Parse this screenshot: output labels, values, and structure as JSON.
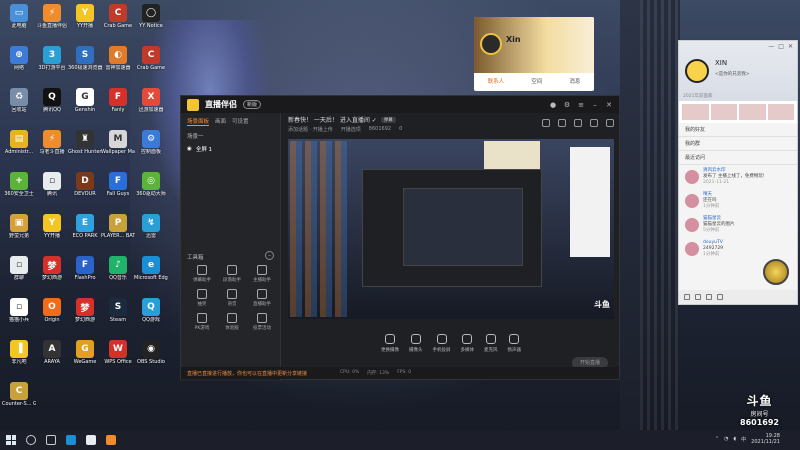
{
  "desktop": {
    "icons": [
      {
        "label": "此电脑",
        "color": "#4a90d9",
        "glyph": "▭"
      },
      {
        "label": "斗鱼直播伴侣",
        "color": "#f08c2c",
        "glyph": "⚡"
      },
      {
        "label": "YY开播",
        "color": "#f3c623",
        "glyph": "Y"
      },
      {
        "label": "Crab Game",
        "color": "#c0392b",
        "glyph": "C"
      },
      {
        "label": "YY Notice",
        "color": "#222",
        "glyph": "◯"
      },
      {
        "label": "网络",
        "color": "#3e7ad8",
        "glyph": "⊕"
      },
      {
        "label": "3D打游平台",
        "color": "#2a9fd6",
        "glyph": "3"
      },
      {
        "label": "360极速浏览器",
        "color": "#2f6fbf",
        "glyph": "S"
      },
      {
        "label": "雷神加速器",
        "color": "#e07b2a",
        "glyph": "◐"
      },
      {
        "label": "Crab Game",
        "color": "#c0392b",
        "glyph": "C"
      },
      {
        "label": "回收站",
        "color": "#7a8da8",
        "glyph": "♻"
      },
      {
        "label": "腾讯QQ",
        "color": "#111",
        "glyph": "Q"
      },
      {
        "label": "Genshin",
        "color": "#ffffff",
        "glyph": "G"
      },
      {
        "label": "Fanly",
        "color": "#d6302b",
        "glyph": "F"
      },
      {
        "label": "迅游加速器",
        "color": "#e24b3a",
        "glyph": "X"
      },
      {
        "label": "Administr...",
        "color": "#e6b422",
        "glyph": "▤"
      },
      {
        "label": "马老斗直播",
        "color": "#f08c2c",
        "glyph": "⚡"
      },
      {
        "label": "Ghost Hunters",
        "color": "#333",
        "glyph": "♜"
      },
      {
        "label": "Wallpaper Maker",
        "color": "#d6d6d6",
        "glyph": "M"
      },
      {
        "label": "控制面板",
        "color": "#3a7bd5",
        "glyph": "⚙"
      },
      {
        "label": "360安全卫士",
        "color": "#5bb33a",
        "glyph": "+"
      },
      {
        "label": "腾讯",
        "color": "#e9ecef",
        "glyph": "▫"
      },
      {
        "label": "DEVOUR",
        "color": "#7a3a1a",
        "glyph": "D"
      },
      {
        "label": "Fall Guys",
        "color": "#2a6fd8",
        "glyph": "F"
      },
      {
        "label": "360驱动大师",
        "color": "#5bb33a",
        "glyph": "◎"
      },
      {
        "label": "野蛮兄弟",
        "color": "#d7a13a",
        "glyph": "▣"
      },
      {
        "label": "YY开播",
        "color": "#f3c623",
        "glyph": "Y"
      },
      {
        "label": "ECO PARK",
        "color": "#2fa1e0",
        "glyph": "E"
      },
      {
        "label": "PLAYER... BATTLEGR...",
        "color": "#c9a13a",
        "glyph": "P"
      },
      {
        "label": "迅雷",
        "color": "#2a9fd6",
        "glyph": "↯"
      },
      {
        "label": "群聊",
        "color": "#e9ecef",
        "glyph": "▫"
      },
      {
        "label": "梦幻西游",
        "color": "#d6302b",
        "glyph": "梦"
      },
      {
        "label": "FlashPro",
        "color": "#2a63c9",
        "glyph": "F"
      },
      {
        "label": "QQ音乐",
        "color": "#1fb46a",
        "glyph": "♪"
      },
      {
        "label": "Microsoft Edge",
        "color": "#1b8fd6",
        "glyph": "e"
      },
      {
        "label": "猫猫小兵",
        "color": "#ffffff",
        "glyph": "▫"
      },
      {
        "label": "Origin",
        "color": "#f06b1a",
        "glyph": "O"
      },
      {
        "label": "梦幻西游",
        "color": "#d6302b",
        "glyph": "梦"
      },
      {
        "label": "Steam",
        "color": "#1c2a3e",
        "glyph": "S"
      },
      {
        "label": "QQ游戏",
        "color": "#2a9fd6",
        "glyph": "Q"
      },
      {
        "label": "非凡吧",
        "color": "#f3c623",
        "glyph": "▐"
      },
      {
        "label": "ARAYA",
        "color": "#333",
        "glyph": "A"
      },
      {
        "label": "WeGame",
        "color": "#e0a020",
        "glyph": "G"
      },
      {
        "label": "WPS Office",
        "color": "#d6302b",
        "glyph": "W"
      },
      {
        "label": "OBS Studio",
        "color": "#222",
        "glyph": "◉"
      },
      {
        "label": "Counter-S... Global Off...",
        "color": "#c9a13a",
        "glyph": "C"
      }
    ]
  },
  "streamer_app": {
    "app_name": "直播伴侣",
    "version_badge": "新版",
    "tabs": [
      "场景面板",
      "画面",
      "可设置"
    ],
    "active_tab": "场景面板",
    "scene_header": "场景一",
    "scene_item": "全屏 1",
    "room_title": "新春快！ 一天后！ 进入直播间 ✓",
    "room_chip": "弹幕",
    "room_sub": [
      "添加话题 · 开播上传",
      "开播选项",
      "8601692"
    ],
    "online_count": "0",
    "tools_header": "工具箱",
    "tools": [
      "弹幕助手",
      "段落助手",
      "主播助手",
      "抽奖",
      "语音",
      "直播助手",
      "PK游戏",
      "体验服",
      "投票活动"
    ],
    "controls": [
      "更换摄像",
      "摄像头",
      "手机投屏",
      "多媒体",
      "麦克风",
      "扬声器"
    ],
    "start_label": "开始直播",
    "status_message": "直播已直接进行播放，你也可以在直播中更新分享链接",
    "stats": [
      "CPU: 0%",
      "内存: 13%",
      "FPS: 0"
    ]
  },
  "profile_card": {
    "name": "Xin",
    "tabs": [
      "联系人",
      "空间",
      "消息"
    ],
    "active_tab": "联系人"
  },
  "qq_panel": {
    "name": "XIN",
    "signature": "<是你的兄弟我>",
    "date": "2021年前面家",
    "window_controls": [
      "—",
      "□",
      "✕"
    ],
    "sections": [
      "我的好友",
      "我的群",
      "最近访问"
    ],
    "posts": [
      {
        "author": "清风云水印",
        "text": "发布了 主播上线了，免费畅玩!",
        "time": "2021-11-21"
      },
      {
        "author": "晴天",
        "text": "还在吗",
        "time": "1分钟前"
      },
      {
        "author": "猫猫星云",
        "text": "猫猫星云的图片",
        "time": "5分钟前"
      },
      {
        "author": "douyuTV",
        "text": "2492729",
        "time": "1分钟前"
      }
    ]
  },
  "watermark": {
    "logo": "斗鱼",
    "sub": "房间号",
    "room_id": "8601692"
  },
  "taskbar": {
    "time": "19:28",
    "date": "2021/11/21",
    "lang": "中"
  }
}
